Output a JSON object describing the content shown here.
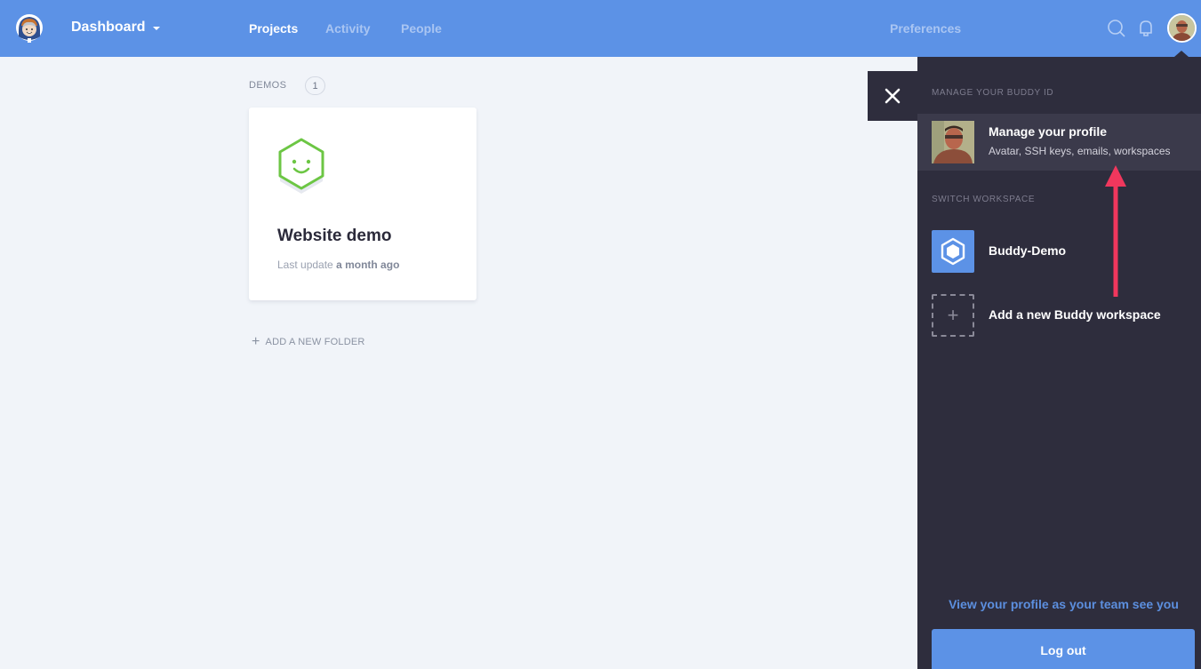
{
  "topbar": {
    "workspace_menu_label": "Dashboard",
    "nav": [
      {
        "label": "Projects",
        "active": true
      },
      {
        "label": "Activity",
        "active": false
      },
      {
        "label": "People",
        "active": false
      }
    ],
    "preferences_label": "Preferences",
    "icons": [
      "buddy-logo-icon",
      "search-icon",
      "bell-icon",
      "user-avatar"
    ]
  },
  "main": {
    "folder": {
      "name": "DEMOS",
      "count": "1"
    },
    "project": {
      "title": "Website demo",
      "meta_prefix": "Last update",
      "meta_time": "a month ago"
    },
    "add_folder_label": "ADD A NEW FOLDER"
  },
  "panel": {
    "buddy_id_heading": "MANAGE YOUR BUDDY ID",
    "profile_title": "Manage your profile",
    "profile_subtitle": "Avatar, SSH keys, emails, workspaces",
    "switch_heading": "SWITCH WORKSPACE",
    "workspaces": [
      {
        "name": "Buddy-Demo"
      }
    ],
    "add_workspace_label": "Add a new Buddy workspace",
    "view_profile_link": "View your profile as your team see you",
    "logout_label": "Log out"
  },
  "colors": {
    "brand_blue": "#5c92e6",
    "panel_dark": "#2e2d3d",
    "project_green": "#6cc644",
    "annotation_red": "#f0375d"
  }
}
